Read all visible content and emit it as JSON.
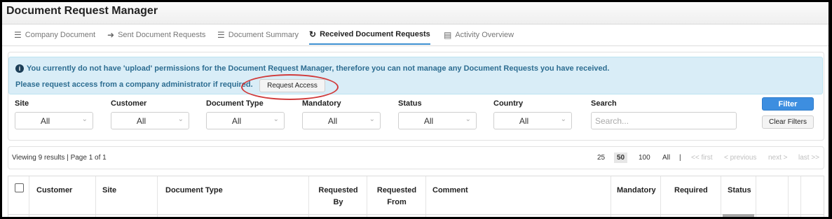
{
  "app": {
    "title": "Document Request Manager"
  },
  "tabs": [
    {
      "label": "Company Document",
      "icon": "list-icon"
    },
    {
      "label": "Sent Document Requests",
      "icon": "arrow-right-icon"
    },
    {
      "label": "Document Summary",
      "icon": "list-icon"
    },
    {
      "label": "Received Document Requests",
      "icon": "refresh-icon",
      "active": true
    },
    {
      "label": "Activity Overview",
      "icon": "table-icon"
    }
  ],
  "alert": {
    "line1": "You currently do not have 'upload' permissions for the Document Request Manager, therefore you can not manage any Document Requests you have received.",
    "line2": "Please request access from a company administrator if required.",
    "button": "Request Access"
  },
  "filters": {
    "site": {
      "label": "Site",
      "value": "All"
    },
    "customer": {
      "label": "Customer",
      "value": "All"
    },
    "document_type": {
      "label": "Document Type",
      "value": "All"
    },
    "mandatory": {
      "label": "Mandatory",
      "value": "All"
    },
    "status": {
      "label": "Status",
      "value": "All"
    },
    "country": {
      "label": "Country",
      "value": "All"
    },
    "search": {
      "label": "Search",
      "placeholder": "Search..."
    },
    "filter_button": "Filter",
    "clear_button": "Clear Filters"
  },
  "pagination": {
    "viewing": "Viewing 9 results | Page 1 of 1",
    "size_25": "25",
    "size_50": "50",
    "size_100": "100",
    "size_all": "All",
    "separator": "|",
    "first": "<< first",
    "previous": "< previous",
    "next": "next >",
    "last": "last >>"
  },
  "table": {
    "columns": {
      "customer": "Customer",
      "site": "Site",
      "document_type": "Document Type",
      "requested_by_1": "Requested",
      "requested_by_2": "By",
      "requested_from_1": "Requested",
      "requested_from_2": "From",
      "comment": "Comment",
      "mandatory": "Mandatory",
      "required": "Required",
      "status": "Status"
    }
  },
  "colors": {
    "accent": "#3d8ee0",
    "alert_bg": "#d9edf7",
    "alert_text": "#2d6d91",
    "highlight": "#d13b3b"
  }
}
